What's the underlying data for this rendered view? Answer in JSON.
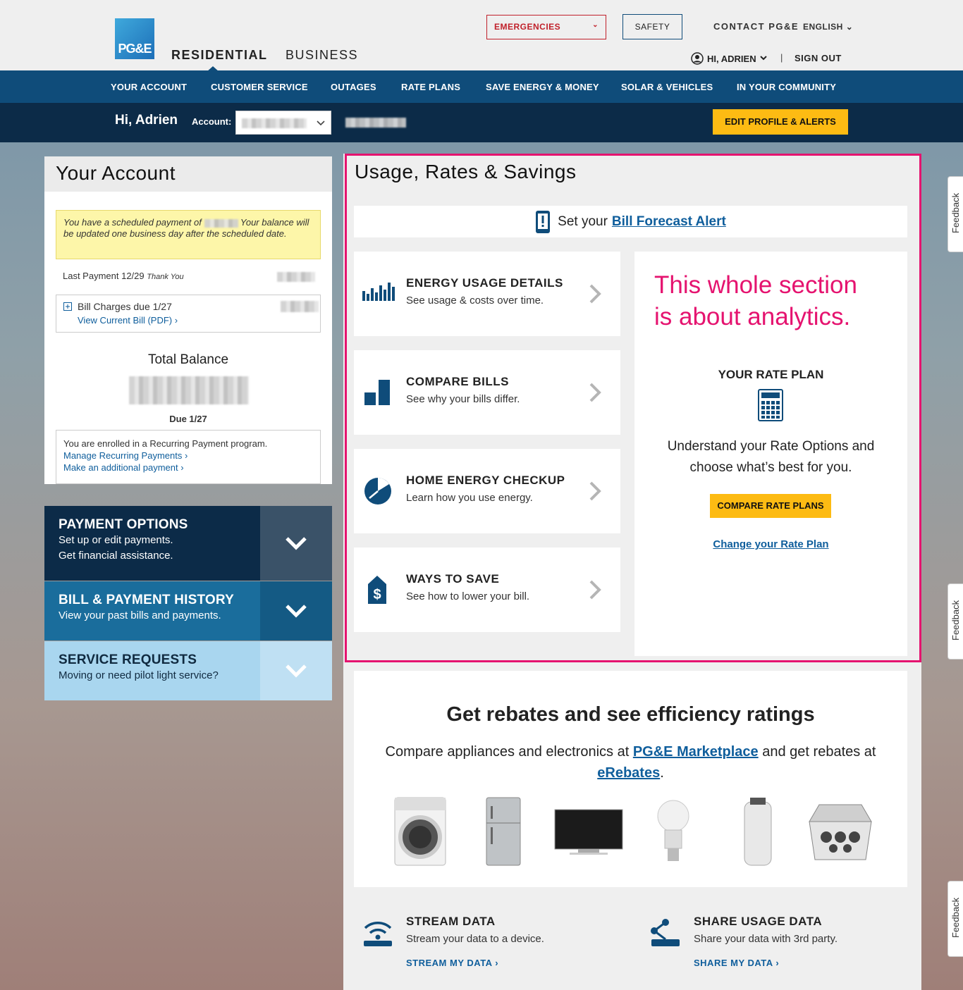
{
  "header": {
    "logo_text": "PG&E",
    "tabs": [
      "RESIDENTIAL",
      "BUSINESS"
    ],
    "emergencies": "EMERGENCIES",
    "safety": "SAFETY",
    "contact": "CONTACT PG&E",
    "language": "ENGLISH",
    "user": "HI, ADRIEN",
    "separator": "|",
    "signout": "SIGN OUT"
  },
  "nav": [
    "YOUR ACCOUNT",
    "CUSTOMER SERVICE",
    "OUTAGES",
    "RATE PLANS",
    "SAVE ENERGY & MONEY",
    "SOLAR & VEHICLES",
    "IN YOUR COMMUNITY"
  ],
  "account_bar": {
    "greeting": "Hi, Adrien",
    "account_label": "Account:",
    "edit_button": "EDIT PROFILE & ALERTS"
  },
  "your_account": {
    "title": "Your Account",
    "notice_a": "You have a scheduled payment of",
    "notice_b": "Your balance will be updated one business day after the scheduled date.",
    "last_payment": "Last Payment 12/29",
    "thank_you": "Thank You",
    "bill_charges": "Bill Charges due 1/27",
    "view_bill": "View Current Bill (PDF)",
    "total_label": "Total Balance",
    "due": "Due 1/27",
    "recurring_text": "You are enrolled in a Recurring Payment program.",
    "manage_link": "Manage Recurring Payments",
    "additional_link": "Make an additional payment"
  },
  "accordions": [
    {
      "title": "PAYMENT OPTIONS",
      "line1": "Set up or edit payments.",
      "line2": "Get financial assistance."
    },
    {
      "title": "BILL & PAYMENT HISTORY",
      "line1": "View your past bills and payments."
    },
    {
      "title": "SERVICE REQUESTS",
      "line1": "Moving or need pilot light service?"
    }
  ],
  "usage": {
    "title": "Usage, Rates & Savings",
    "forecast_text": "Set your",
    "forecast_link": "Bill Forecast Alert",
    "tiles": [
      {
        "title": "ENERGY USAGE DETAILS",
        "desc": "See usage & costs over time."
      },
      {
        "title": "COMPARE BILLS",
        "desc": "See why your bills differ."
      },
      {
        "title": "HOME ENERGY CHECKUP",
        "desc": "Learn how you use energy."
      },
      {
        "title": "WAYS TO SAVE",
        "desc": "See how to lower your bill."
      }
    ],
    "annotation_1": "This whole section",
    "annotation_2": "is about analytics.",
    "rate_title": "YOUR RATE PLAN",
    "rate_text": "Understand your Rate Options and choose what’s best for you.",
    "compare_button": "COMPARE RATE PLANS",
    "change_link": "Change your Rate Plan"
  },
  "rebates": {
    "title": "Get rebates and see efficiency ratings",
    "text_a": "Compare appliances and electronics at",
    "link_a": "PG&E Marketplace",
    "text_b": "and get rebates at",
    "link_b": "eRebates",
    "text_c": "."
  },
  "data_share": [
    {
      "title": "STREAM DATA",
      "desc": "Stream your data to a device.",
      "link": "STREAM MY DATA"
    },
    {
      "title": "SHARE USAGE DATA",
      "desc": "Share your data with 3rd party.",
      "link": "SHARE MY DATA"
    }
  ],
  "feedback": "Feedback",
  "colors": {
    "brand_blue": "#0f4c7a",
    "dark_navy": "#0c2b48",
    "accent_yellow": "#fdbb13",
    "annotation_pink": "#e5136f"
  }
}
